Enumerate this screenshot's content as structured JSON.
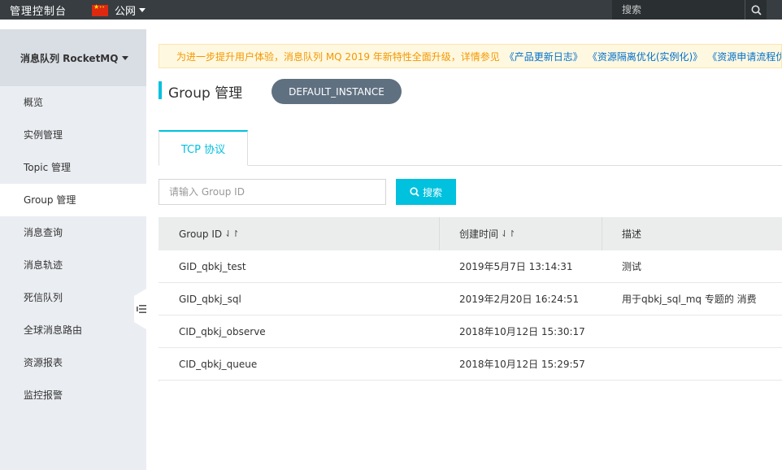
{
  "topbar": {
    "console_title": "管理控制台",
    "region_label": "公网",
    "search_placeholder": "搜索"
  },
  "sidebar": {
    "product_title": "消息队列 RocketMQ",
    "items": [
      {
        "label": "概览",
        "active": false
      },
      {
        "label": "实例管理",
        "active": false
      },
      {
        "label": "Topic 管理",
        "active": false
      },
      {
        "label": "Group 管理",
        "active": true
      },
      {
        "label": "消息查询",
        "active": false
      },
      {
        "label": "消息轨迹",
        "active": false
      },
      {
        "label": "死信队列",
        "active": false
      },
      {
        "label": "全球消息路由",
        "active": false
      },
      {
        "label": "资源报表",
        "active": false
      },
      {
        "label": "监控报警",
        "active": false
      }
    ]
  },
  "notice": {
    "text": "为进一步提升用户体验，消息队列 MQ 2019 年新特性全面升级，详情参见",
    "links": [
      "《产品更新日志》",
      "《资源隔离优化(实例化)》",
      "《资源申请流程优"
    ]
  },
  "page": {
    "title": "Group 管理",
    "instance": "DEFAULT_INSTANCE"
  },
  "tabs": [
    {
      "label": "TCP 协议",
      "active": true
    }
  ],
  "search": {
    "placeholder": "请输入 Group ID",
    "button_label": "搜索"
  },
  "table": {
    "columns": [
      "Group ID",
      "创建时间",
      "描述"
    ],
    "rows": [
      {
        "group_id": "GID_qbkj_test",
        "created": "2019年5月7日 13:14:31",
        "desc": "测试"
      },
      {
        "group_id": "GID_qbkj_sql",
        "created": "2019年2月20日 16:24:51",
        "desc": "用于qbkj_sql_mq 专题的 消费"
      },
      {
        "group_id": "CID_qbkj_observe",
        "created": "2018年10月12日 15:30:17",
        "desc": ""
      },
      {
        "group_id": "CID_qbkj_queue",
        "created": "2018年10月12日 15:29:57",
        "desc": ""
      }
    ]
  },
  "colors": {
    "topbar_bg": "#373d41",
    "accent": "#00c1de",
    "notice_text": "#f39800",
    "notice_link": "#0070cc",
    "instance_pill": "#5f7081"
  },
  "icons": {
    "top_search": "search-icon",
    "search_button": "search-icon",
    "sort": "sort-icon",
    "collapse": "menu-collapse-icon"
  }
}
